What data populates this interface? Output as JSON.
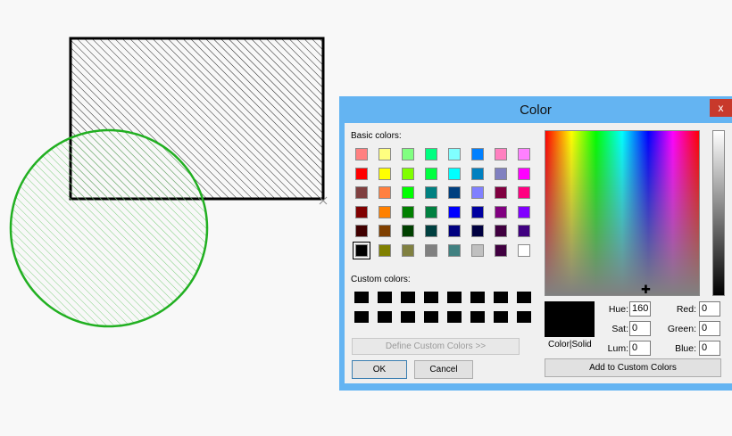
{
  "dialog": {
    "title": "Color",
    "close_label": "x",
    "basic_colors_label": "Basic colors:",
    "custom_colors_label": "Custom colors:",
    "define_custom_label": "Define Custom Colors >>",
    "ok_label": "OK",
    "cancel_label": "Cancel",
    "color_solid_label": "Color|Solid",
    "add_custom_label": "Add to Custom Colors",
    "hue_label": "Hue:",
    "sat_label": "Sat:",
    "lum_label": "Lum:",
    "red_label": "Red:",
    "green_label": "Green:",
    "blue_label": "Blue:",
    "hue_value": "160",
    "sat_value": "0",
    "lum_value": "0",
    "red_value": "0",
    "green_value": "0",
    "blue_value": "0",
    "selected_color": "#000000",
    "selected_swatch_index": 40,
    "basic_colors": [
      "#ff8080",
      "#ffff80",
      "#80ff80",
      "#00ff80",
      "#80ffff",
      "#0080ff",
      "#ff80c0",
      "#ff80ff",
      "#ff0000",
      "#ffff00",
      "#80ff00",
      "#00ff40",
      "#00ffff",
      "#0080c0",
      "#8080c0",
      "#ff00ff",
      "#804040",
      "#ff8040",
      "#00ff00",
      "#008080",
      "#004080",
      "#8080ff",
      "#800040",
      "#ff0080",
      "#800000",
      "#ff8000",
      "#008000",
      "#008040",
      "#0000ff",
      "#0000a0",
      "#800080",
      "#8000ff",
      "#400000",
      "#804000",
      "#004000",
      "#004040",
      "#000080",
      "#000040",
      "#400040",
      "#400080",
      "#000000",
      "#808000",
      "#808040",
      "#808080",
      "#408080",
      "#c0c0c0",
      "#400040",
      "#ffffff"
    ],
    "custom_colors": [
      "#000000",
      "#000000",
      "#000000",
      "#000000",
      "#000000",
      "#000000",
      "#000000",
      "#000000",
      "#000000",
      "#000000",
      "#000000",
      "#000000",
      "#000000",
      "#000000",
      "#000000",
      "#000000"
    ]
  },
  "drawing": {
    "rect_stroke": "#000000",
    "circle_stroke": "#22b022",
    "circle_hatch": "#7fcf7f"
  }
}
